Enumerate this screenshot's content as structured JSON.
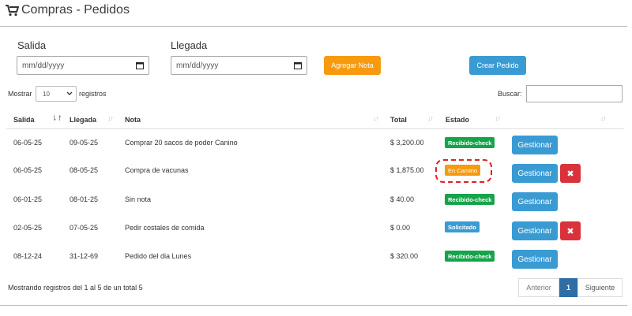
{
  "header": {
    "title": "Compras - Pedidos",
    "icon": "cart-icon"
  },
  "filters": {
    "salida_label": "Salida",
    "llegada_label": "Llegada",
    "date_placeholder": "mm/dd/yyyy",
    "add_note_label": "Agregar Nota",
    "create_order_label": "Crear Pedido"
  },
  "table_controls": {
    "show_label": "Mostrar",
    "page_size": "10",
    "records_label": "registros",
    "search_label": "Buscar:"
  },
  "columns": [
    "Salida",
    "Llegada",
    "Nota",
    "Total",
    "Estado"
  ],
  "rows": [
    {
      "salida": "06-05-25",
      "llegada": "09-05-25",
      "nota": "Comprar 20 sacos de poder Canino",
      "total": "$ 3,200.00",
      "estado": "Recibido-check",
      "action": "Gestionar"
    },
    {
      "salida": "06-05-25",
      "llegada": "08-05-25",
      "nota": "Compra de vacunas",
      "total": "$ 1,875.00",
      "estado": "En Camino",
      "action": "Gestionar",
      "delete": "✖"
    },
    {
      "salida": "06-01-25",
      "llegada": "08-01-25",
      "nota": "Sin nota",
      "total": "$ 40.00",
      "estado": "Recibido-check",
      "action": "Gestionar"
    },
    {
      "salida": "02-05-25",
      "llegada": "07-05-25",
      "nota": "Pedir costales de comida",
      "total": "$ 0.00",
      "estado": "Solicitado",
      "action": "Gestionar",
      "delete": "✖"
    },
    {
      "salida": "08-12-24",
      "llegada": "31-12-69",
      "nota": "Pedido del dia Lunes",
      "total": "$ 320.00",
      "estado": "Recibido-check",
      "action": "Gestionar"
    }
  ],
  "footer": {
    "summary": "Mostrando registros del 1 al 5 de un total 5",
    "prev_label": "Anterior",
    "current_page": "1",
    "next_label": "Siguiente"
  },
  "colors": {
    "accent_orange": "#f79a0e",
    "accent_blue": "#3a9bd3",
    "status_green": "#16a34a",
    "delete_red": "#d9323a",
    "page_active": "#2f6ea5"
  }
}
